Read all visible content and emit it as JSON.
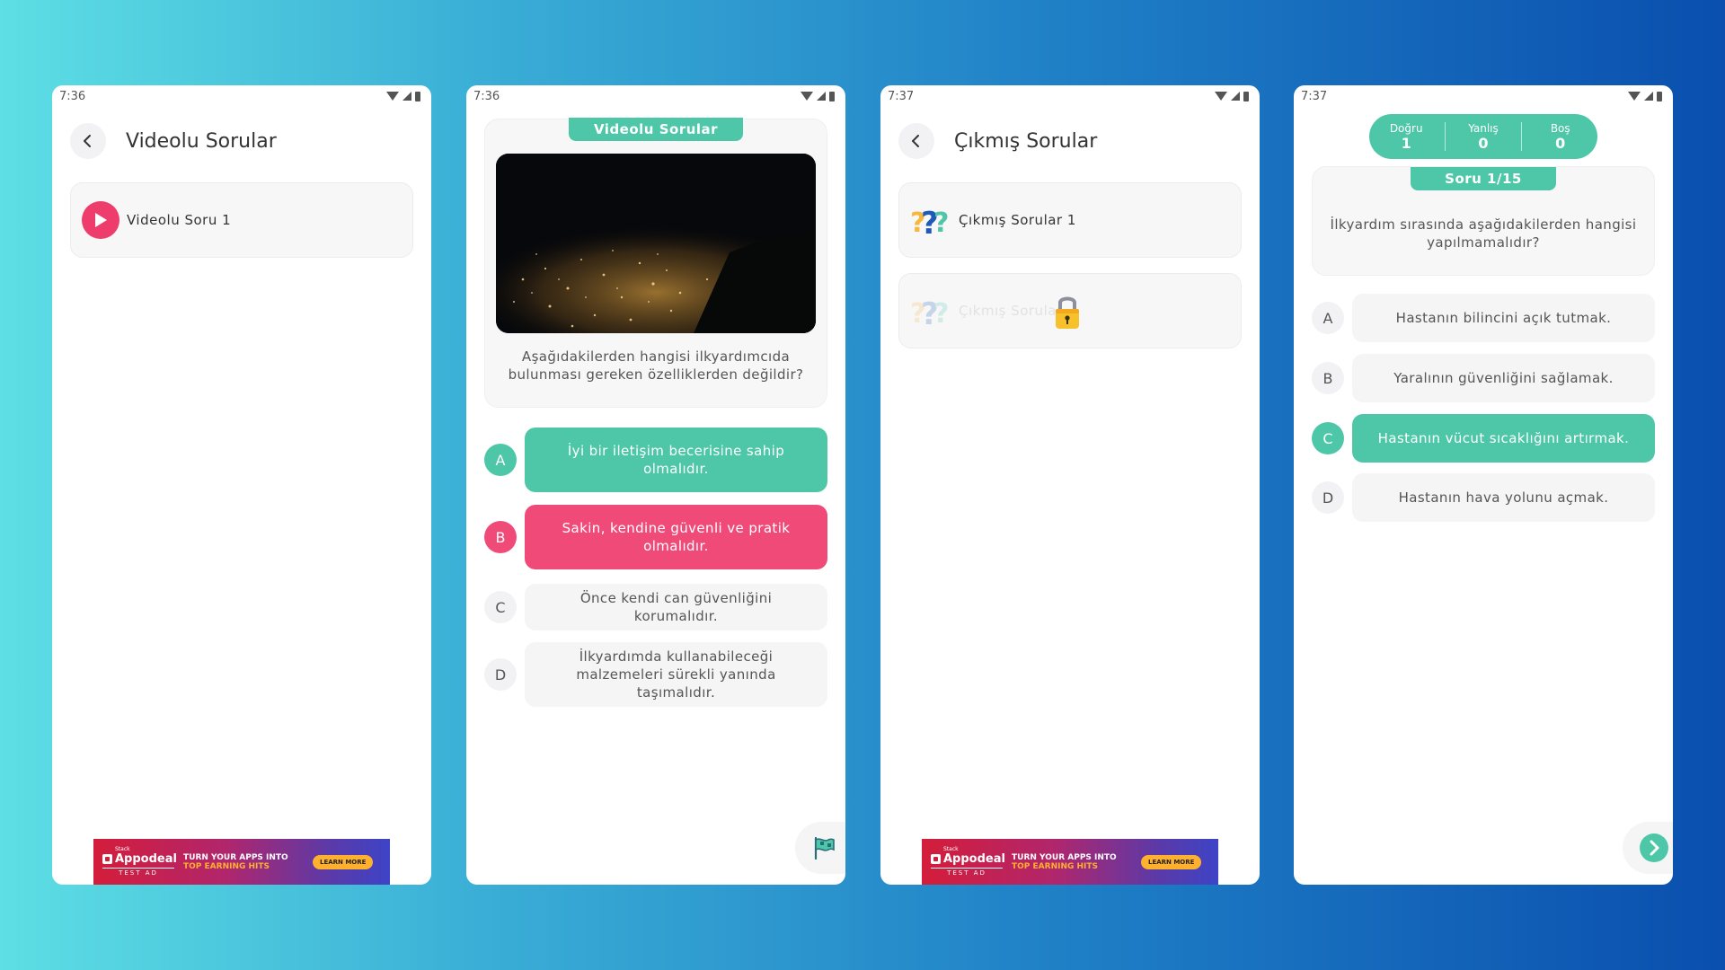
{
  "screens": {
    "videolu_list": {
      "status": {
        "time": "7:36"
      },
      "header": {
        "title": "Videolu Sorular"
      },
      "items": [
        {
          "label": "Videolu Soru 1"
        }
      ]
    },
    "video_question": {
      "status": {
        "time": "7:36"
      },
      "tag": "Videolu Sorular",
      "question": "Aşağıdakilerden hangisi ilkyardımcıda bulunması gereken özelliklerden değildir?",
      "options": [
        {
          "letter": "A",
          "text": "İyi bir iletişim becerisine sahip olmalıdır.",
          "state": "correct"
        },
        {
          "letter": "B",
          "text": "Sakin, kendine güvenli ve pratik olmalıdır.",
          "state": "wrong"
        },
        {
          "letter": "C",
          "text": "Önce kendi can güvenliğini korumalıdır.",
          "state": "neutral"
        },
        {
          "letter": "D",
          "text": "İlkyardımda kullanabileceği malzemeleri sürekli yanında taşımalıdır.",
          "state": "neutral"
        }
      ]
    },
    "cikmis_list": {
      "status": {
        "time": "7:37"
      },
      "header": {
        "title": "Çıkmış Sorular"
      },
      "items": [
        {
          "label": "Çıkmış Sorular 1",
          "locked": false
        },
        {
          "label": "Çıkmış Sorular",
          "locked": true
        }
      ]
    },
    "quiz": {
      "status": {
        "time": "7:37"
      },
      "score": {
        "dogru_label": "Doğru",
        "dogru": "1",
        "yanlis_label": "Yanlış",
        "yanlis": "0",
        "bos_label": "Boş",
        "bos": "0"
      },
      "tag": "Soru 1/15",
      "question": "İlkyardım sırasında aşağıdakilerden hangisi yapılmamalıdır?",
      "options": [
        {
          "letter": "A",
          "text": "Hastanın bilincini açık tutmak.",
          "state": "neutral"
        },
        {
          "letter": "B",
          "text": "Yaralının güvenliğini sağlamak.",
          "state": "neutral"
        },
        {
          "letter": "C",
          "text": "Hastanın vücut sıcaklığını artırmak.",
          "state": "correct"
        },
        {
          "letter": "D",
          "text": "Hastanın hava yolunu açmak.",
          "state": "neutral"
        }
      ]
    }
  },
  "ad": {
    "small": "Stack",
    "brand": "Appodeal",
    "test_label": "TEST AD",
    "line1": "TURN YOUR APPS INTO",
    "line2": "TOP EARNING HITS",
    "cta": "LEARN MORE"
  },
  "colors": {
    "accent_green": "#4dc7a8",
    "accent_red": "#f04a78",
    "play_pink": "#ee3c6c"
  },
  "icons": [
    "back-arrow-icon",
    "play-icon",
    "question-marks-icon",
    "lock-icon",
    "flag-icon",
    "next-arrow-icon",
    "wifi-icon",
    "signal-icon",
    "battery-icon"
  ]
}
